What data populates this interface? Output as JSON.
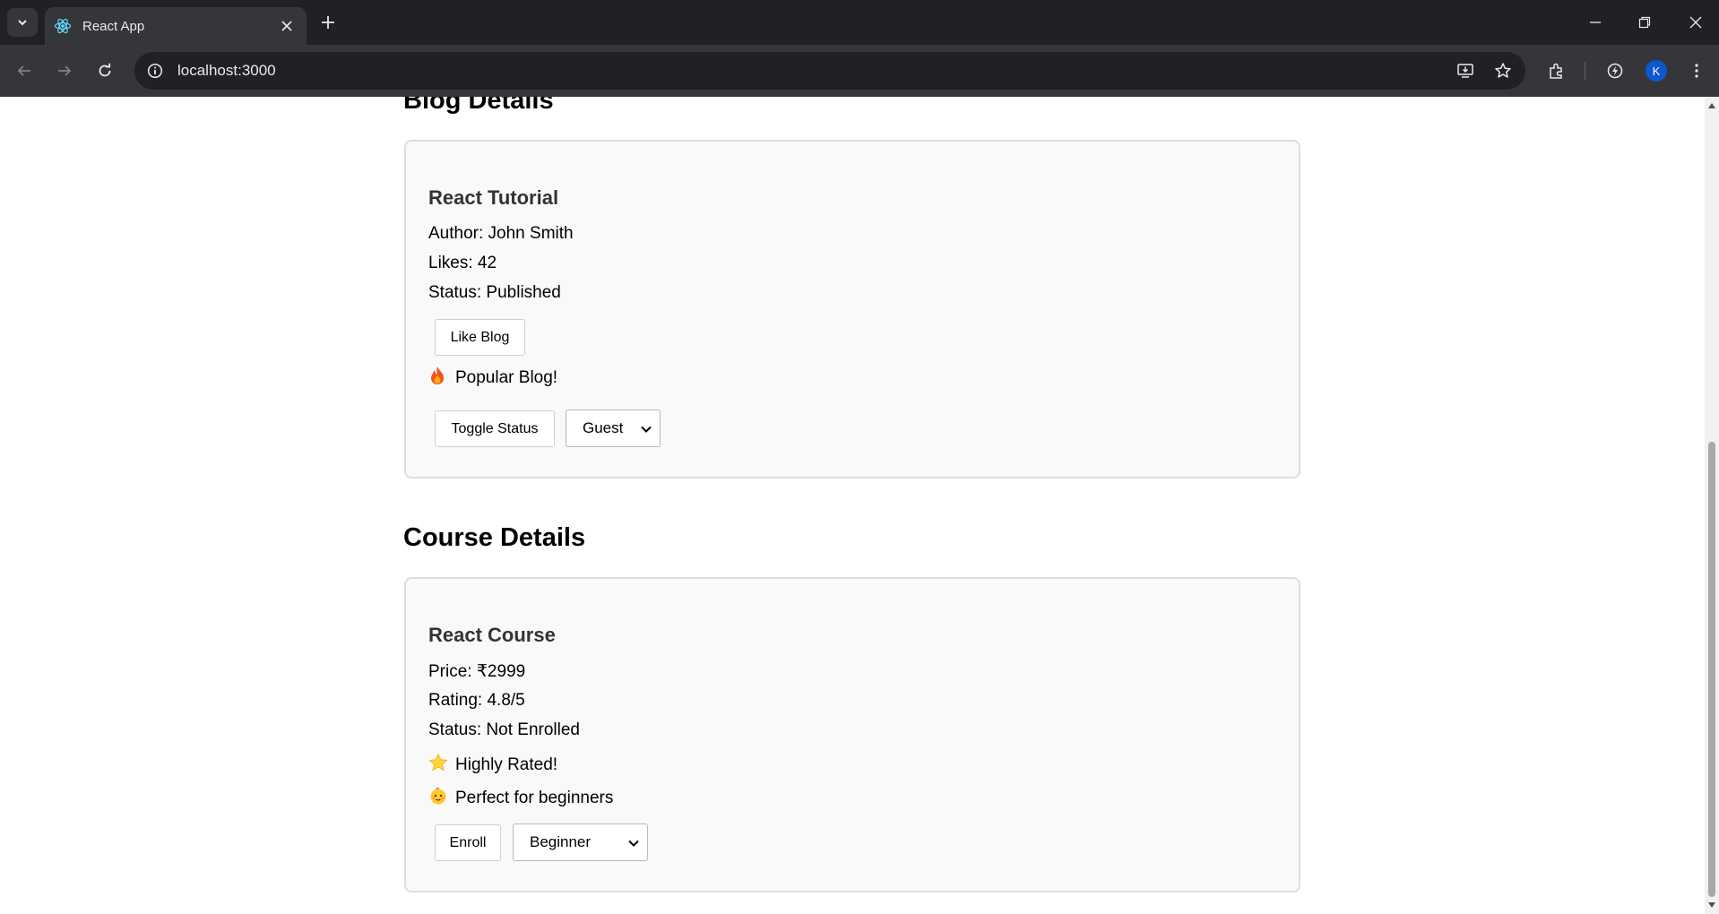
{
  "browser": {
    "tab_title": "React App",
    "url": "localhost:3000",
    "profile_initial": "K"
  },
  "blog": {
    "section_title": "Blog Details",
    "title": "React Tutorial",
    "author": "Author: John Smith",
    "likes": "Likes: 42",
    "status": "Status: Published",
    "like_button": "Like Blog",
    "popular_text": "Popular Blog!",
    "toggle_button": "Toggle Status",
    "role_select": "Guest"
  },
  "course": {
    "section_title": "Course Details",
    "title": "React Course",
    "price": "Price: ₹2999",
    "rating": "Rating: 4.8/5",
    "status": "Status: Not Enrolled",
    "highly_rated_text": "Highly Rated!",
    "beginner_text": "Perfect for beginners",
    "enroll_button": "Enroll",
    "level_select": "Beginner"
  }
}
